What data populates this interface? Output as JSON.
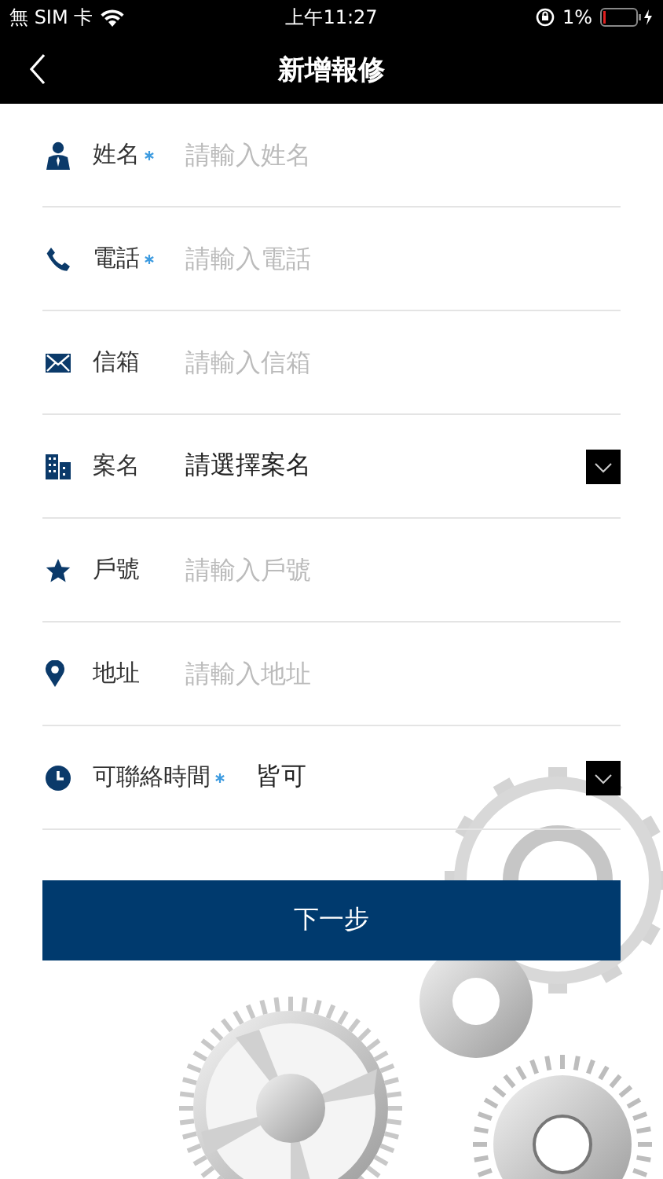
{
  "status_bar": {
    "carrier": "無 SIM 卡",
    "time": "上午11:27",
    "battery": "1%"
  },
  "nav": {
    "title": "新增報修"
  },
  "fields": [
    {
      "kind": "input",
      "label": "姓名",
      "required": true,
      "placeholder": "請輸入姓名"
    },
    {
      "kind": "input",
      "label": "電話",
      "required": true,
      "placeholder": "請輸入電話"
    },
    {
      "kind": "input",
      "label": "信箱",
      "required": false,
      "placeholder": "請輸入信箱"
    },
    {
      "kind": "select",
      "label": "案名",
      "required": false,
      "value": "請選擇案名"
    },
    {
      "kind": "input",
      "label": "戶號",
      "required": false,
      "placeholder": "請輸入戶號"
    },
    {
      "kind": "input",
      "label": "地址",
      "required": false,
      "placeholder": "請輸入地址"
    },
    {
      "kind": "select",
      "label": "可聯絡時間",
      "required": true,
      "value": "皆可"
    }
  ],
  "button": "下一步"
}
